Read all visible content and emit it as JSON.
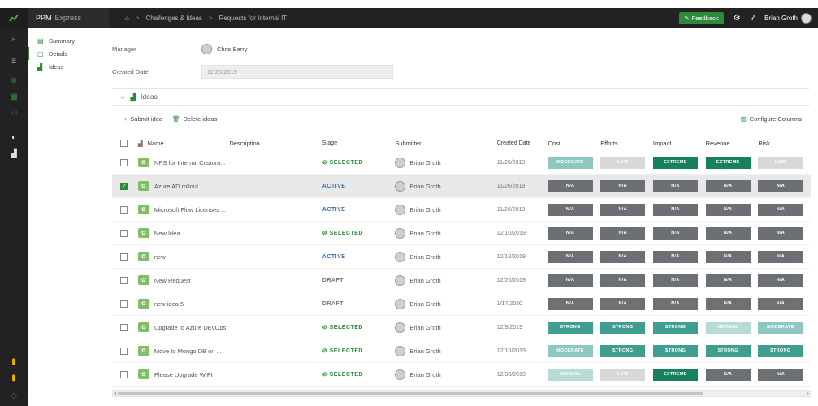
{
  "topbar": {
    "app_name": "PPM",
    "app_sub": "Express",
    "breadcrumb": [
      "Challenges & Ideas",
      "Requests for Internal IT"
    ],
    "feedback_label": "Feedback",
    "help_label": "?",
    "user_name": "Brian Groth"
  },
  "subnav": {
    "items": [
      {
        "label": "Summary",
        "icon": "summary-icon"
      },
      {
        "label": "Details",
        "icon": "details-icon"
      },
      {
        "label": "Ideas",
        "icon": "ideas-icon"
      }
    ]
  },
  "form": {
    "manager_label": "Manager",
    "manager_value": "Chris Barry",
    "created_label": "Created Date",
    "created_value": "11/20/2019"
  },
  "ideas_section": {
    "title": "Ideas",
    "submit_label": "Submit idea",
    "delete_label": "Delete ideas",
    "configure_label": "Configure Columns"
  },
  "columns": [
    "Name",
    "Description",
    "Stage",
    "Submitter",
    "Created Date",
    "Cost",
    "Efforts",
    "Impact",
    "Revenue",
    "Risk"
  ],
  "badge_colors": {
    "MODERATE": "#8ec6c2",
    "LOW": "#d8d8d8",
    "EXTREME": "#17805f",
    "N/A": "#6c6f73",
    "STRONG": "#3f9e90",
    "NORMAL": "#b7dbd6"
  },
  "rows": [
    {
      "name": "NPS for Internal Custom...",
      "stage": "SELECTED",
      "submitter": "Brian Groth",
      "date": "11/26/2019",
      "selected": false,
      "metrics": [
        "MODERATE",
        "LOW",
        "EXTREME",
        "EXTREME",
        "LOW"
      ]
    },
    {
      "name": "Azure AD rollout",
      "stage": "ACTIVE",
      "submitter": "Brian Groth",
      "date": "11/26/2019",
      "selected": true,
      "metrics": [
        "N/A",
        "N/A",
        "N/A",
        "N/A",
        "N/A"
      ]
    },
    {
      "name": "Microsoft Flow Licenses ...",
      "stage": "ACTIVE",
      "submitter": "Brian Groth",
      "date": "11/26/2019",
      "selected": false,
      "metrics": [
        "N/A",
        "N/A",
        "N/A",
        "N/A",
        "N/A"
      ]
    },
    {
      "name": "New Idea",
      "stage": "SELECTED",
      "submitter": "Brian Groth",
      "date": "12/10/2019",
      "selected": false,
      "metrics": [
        "N/A",
        "N/A",
        "N/A",
        "N/A",
        "N/A"
      ]
    },
    {
      "name": "new",
      "stage": "ACTIVE",
      "submitter": "Brian Groth",
      "date": "12/18/2019",
      "selected": false,
      "metrics": [
        "N/A",
        "N/A",
        "N/A",
        "N/A",
        "N/A"
      ]
    },
    {
      "name": "New Request",
      "stage": "DRAFT",
      "submitter": "Brian Groth",
      "date": "12/20/2019",
      "selected": false,
      "metrics": [
        "N/A",
        "N/A",
        "N/A",
        "N/A",
        "N/A"
      ]
    },
    {
      "name": "new idea 5",
      "stage": "DRAFT",
      "submitter": "Brian Groth",
      "date": "1/17/2020",
      "selected": false,
      "metrics": [
        "N/A",
        "N/A",
        "N/A",
        "N/A",
        "N/A"
      ]
    },
    {
      "name": "Upgrade to Azure DEvOps",
      "stage": "SELECTED",
      "submitter": "Brian Groth",
      "date": "12/9/2019",
      "selected": false,
      "metrics": [
        "STRONG",
        "STRONG",
        "STRONG",
        "NORMAL",
        "MODERATE"
      ]
    },
    {
      "name": "Move to Mongo DB on ...",
      "stage": "SELECTED",
      "submitter": "Brian Groth",
      "date": "12/10/2019",
      "selected": false,
      "metrics": [
        "MODERATE",
        "STRONG",
        "STRONG",
        "STRONG",
        "STRONG"
      ]
    },
    {
      "name": "Please Upgrade WIFI",
      "stage": "SELECTED",
      "submitter": "Brian Groth",
      "date": "12/30/2019",
      "selected": false,
      "metrics": [
        "NORMAL",
        "LOW",
        "EXTREME",
        "N/A",
        "N/A"
      ]
    }
  ]
}
